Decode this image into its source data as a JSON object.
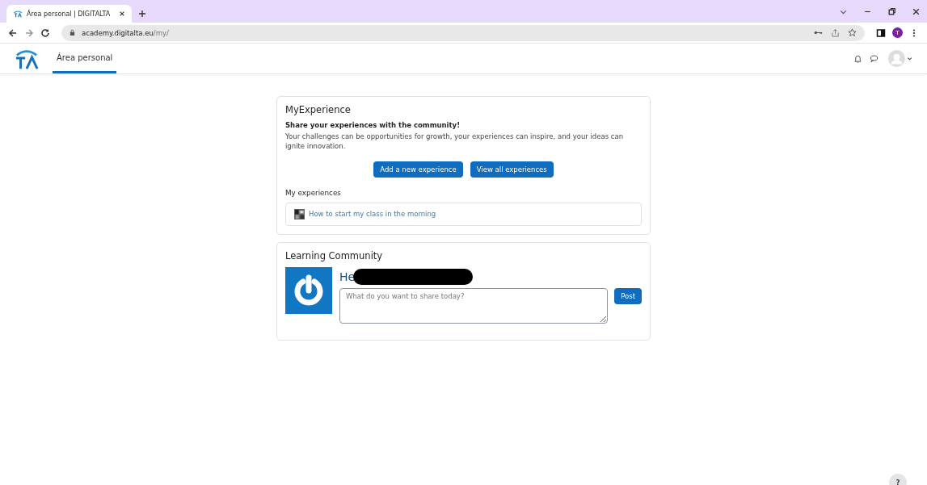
{
  "browser": {
    "tab": {
      "title": "Área personal | DIGITALTA",
      "selected": true
    },
    "url": {
      "host": "academy.digitalta.eu",
      "path": "/my/"
    },
    "profile_initial": "T"
  },
  "nav": {
    "items": [
      {
        "label": "Área personal",
        "selected": true
      }
    ]
  },
  "my_experience": {
    "title": "MyExperience",
    "subtitle": "Share your experiences with the community!",
    "description": "Your challenges can be opportunities for growth, your experiences can inspire, and your ideas can ignite innovation.",
    "buttons": [
      "Add a new experience",
      "View all experiences"
    ],
    "list_title": "My experiences",
    "experiences": [
      {
        "title": "How to start my class in the morning"
      }
    ]
  },
  "learning_community": {
    "title": "Learning Community",
    "greeting": "He",
    "greeting_redacted": true,
    "post_field": {
      "placeholder": "What do you want to share today?"
    },
    "post_button": "Post"
  },
  "help_button": "?"
}
